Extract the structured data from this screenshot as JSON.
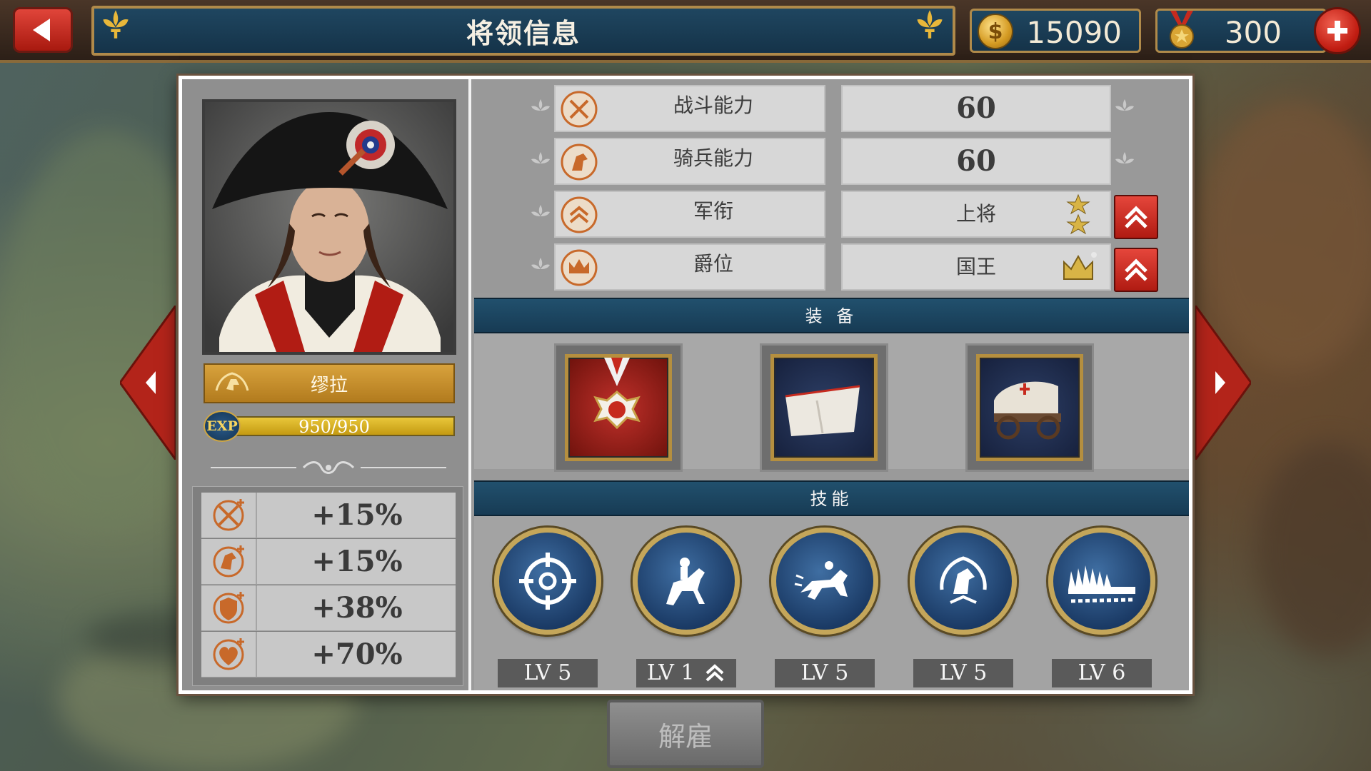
{
  "header": {
    "title": "将领信息"
  },
  "resources": {
    "gold": "15090",
    "medals": "300"
  },
  "general": {
    "name": "缪拉",
    "exp_text": "950/950",
    "exp_label": "EXP",
    "exp_fraction": 1.0
  },
  "bonuses": [
    {
      "icon": "swords-icon",
      "value": "+15%"
    },
    {
      "icon": "cavalry-icon",
      "value": "+15%"
    },
    {
      "icon": "shield-icon",
      "value": "+38%"
    },
    {
      "icon": "heart-icon",
      "value": "+70%"
    }
  ],
  "attributes": [
    {
      "label": "战斗能力",
      "value": "60"
    },
    {
      "label": "骑兵能力",
      "value": "60"
    },
    {
      "label": "军衔",
      "value": "上将"
    },
    {
      "label": "爵位",
      "value": "国王"
    }
  ],
  "sections": {
    "equipment": "装 备",
    "skills": "技能"
  },
  "equipment": [
    "medal-item",
    "tent-item",
    "ambulance-wagon-item"
  ],
  "skills": [
    {
      "icon": "target-icon",
      "level": "LV 5"
    },
    {
      "icon": "horse-rider-icon",
      "level": "LV 1"
    },
    {
      "icon": "cavalry-charge-icon",
      "level": "LV 5"
    },
    {
      "icon": "horse-laurel-icon",
      "level": "LV 5"
    },
    {
      "icon": "bayonet-line-icon",
      "level": "LV 6"
    }
  ],
  "actions": {
    "dismiss": "解雇"
  },
  "colors": {
    "accent_red": "#c8261a",
    "panel_blue": "#1f4660",
    "gold": "#c9a24a"
  }
}
